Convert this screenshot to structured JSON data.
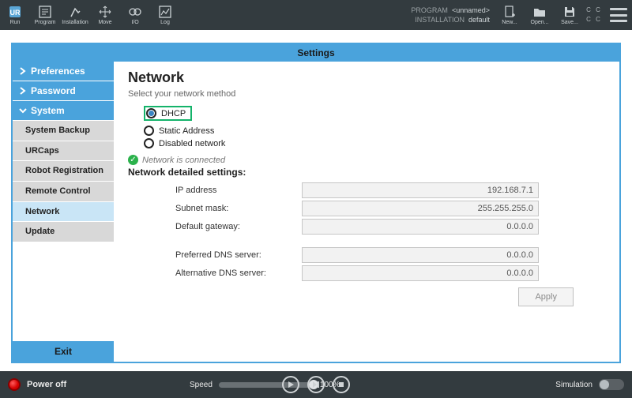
{
  "topbar": {
    "buttons": [
      {
        "name": "run",
        "label": "Run"
      },
      {
        "name": "program",
        "label": "Program"
      },
      {
        "name": "installation",
        "label": "Installation"
      },
      {
        "name": "move",
        "label": "Move"
      },
      {
        "name": "io",
        "label": "I/O"
      },
      {
        "name": "log",
        "label": "Log"
      }
    ],
    "program_label": "PROGRAM",
    "program_value": "<unnamed>",
    "installation_label": "INSTALLATION",
    "installation_value": "default",
    "file_buttons": [
      {
        "name": "new",
        "label": "New..."
      },
      {
        "name": "open",
        "label": "Open..."
      },
      {
        "name": "save",
        "label": "Save..."
      }
    ]
  },
  "panel": {
    "title": "Settings"
  },
  "sidebar": {
    "top": [
      {
        "key": "preferences",
        "label": "Preferences",
        "expanded": false
      },
      {
        "key": "password",
        "label": "Password",
        "expanded": false
      },
      {
        "key": "system",
        "label": "System",
        "expanded": true
      }
    ],
    "system_children": [
      {
        "key": "backup",
        "label": "System Backup"
      },
      {
        "key": "urcaps",
        "label": "URCaps"
      },
      {
        "key": "robotreg",
        "label": "Robot Registration"
      },
      {
        "key": "remote",
        "label": "Remote Control"
      },
      {
        "key": "network",
        "label": "Network",
        "selected": true
      },
      {
        "key": "update",
        "label": "Update"
      }
    ],
    "exit": "Exit"
  },
  "content": {
    "title": "Network",
    "subtext": "Select your network method",
    "radios": [
      {
        "key": "dhcp",
        "label": "DHCP",
        "selected": true,
        "highlighted": true
      },
      {
        "key": "static",
        "label": "Static Address",
        "selected": false
      },
      {
        "key": "disabled",
        "label": "Disabled network",
        "selected": false
      }
    ],
    "status": "Network is connected",
    "detailed_heading": "Network detailed settings:",
    "fields": [
      {
        "key": "ip",
        "label": "IP address",
        "value": "192.168.7.1"
      },
      {
        "key": "subnet",
        "label": "Subnet mask:",
        "value": "255.255.255.0"
      },
      {
        "key": "gateway",
        "label": "Default gateway:",
        "value": "0.0.0.0"
      }
    ],
    "fields2": [
      {
        "key": "dns1",
        "label": "Preferred DNS server:",
        "value": "0.0.0.0"
      },
      {
        "key": "dns2",
        "label": "Alternative DNS server:",
        "value": "0.0.0.0"
      }
    ],
    "apply": "Apply"
  },
  "bottombar": {
    "power": "Power off",
    "speed_label": "Speed",
    "speed_value": "100%",
    "simulation": "Simulation"
  }
}
